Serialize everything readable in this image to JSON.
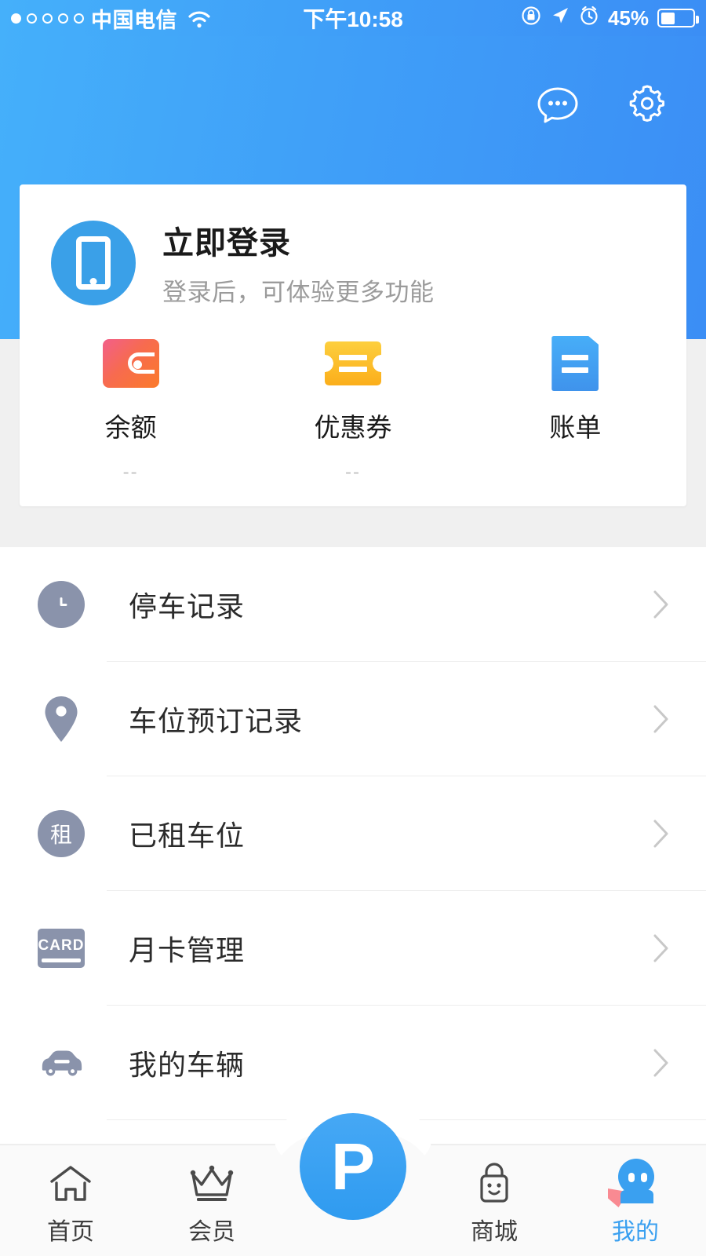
{
  "status_bar": {
    "signal_dots_total": 5,
    "signal_dots_filled": 1,
    "carrier": "中国电信",
    "wifi_icon": "wifi-icon",
    "time": "下午10:58",
    "lock_icon": "rotation-lock-icon",
    "location_icon": "location-arrow-icon",
    "alarm_icon": "alarm-clock-icon",
    "battery_percent": "45%",
    "battery_level": 45
  },
  "header": {
    "message_icon": "chat-bubble-icon",
    "settings_icon": "gear-icon",
    "gradient_start": "#45b0fa",
    "gradient_end": "#3b8ef5"
  },
  "login_card": {
    "avatar_icon": "phone-icon",
    "title": "立即登录",
    "subtitle": "登录后，可体验更多功能",
    "quick_actions": [
      {
        "icon": "wallet-icon",
        "label": "余额",
        "value": "--",
        "color": "#f76b4f"
      },
      {
        "icon": "coupon-ticket-icon",
        "label": "优惠券",
        "value": "--",
        "color": "#fbae1b"
      },
      {
        "icon": "bill-document-icon",
        "label": "账单",
        "value": "",
        "color": "#3f93ec"
      }
    ]
  },
  "menu": {
    "items": [
      {
        "icon": "clock-icon",
        "label": "停车记录",
        "chevron": "chevron-right-icon"
      },
      {
        "icon": "location-pin-icon",
        "label": "车位预订记录",
        "chevron": "chevron-right-icon"
      },
      {
        "icon": "rent-circle-icon",
        "icon_text": "租",
        "label": "已租车位",
        "chevron": "chevron-right-icon"
      },
      {
        "icon": "card-icon",
        "icon_text": "CARD",
        "label": "月卡管理",
        "chevron": "chevron-right-icon"
      },
      {
        "icon": "car-icon",
        "label": "我的车辆",
        "chevron": "chevron-right-icon"
      }
    ]
  },
  "bottom_nav": {
    "active_index": 4,
    "accent_color": "#3aa0f0",
    "items": [
      {
        "icon": "home-icon",
        "label": "首页"
      },
      {
        "icon": "crown-icon",
        "label": "会员"
      },
      {
        "icon": "parking-p-icon",
        "label": "P"
      },
      {
        "icon": "shopping-bag-icon",
        "label": "商城"
      },
      {
        "icon": "profile-mascot-icon",
        "label": "我的"
      }
    ],
    "center_button_label": "P"
  }
}
